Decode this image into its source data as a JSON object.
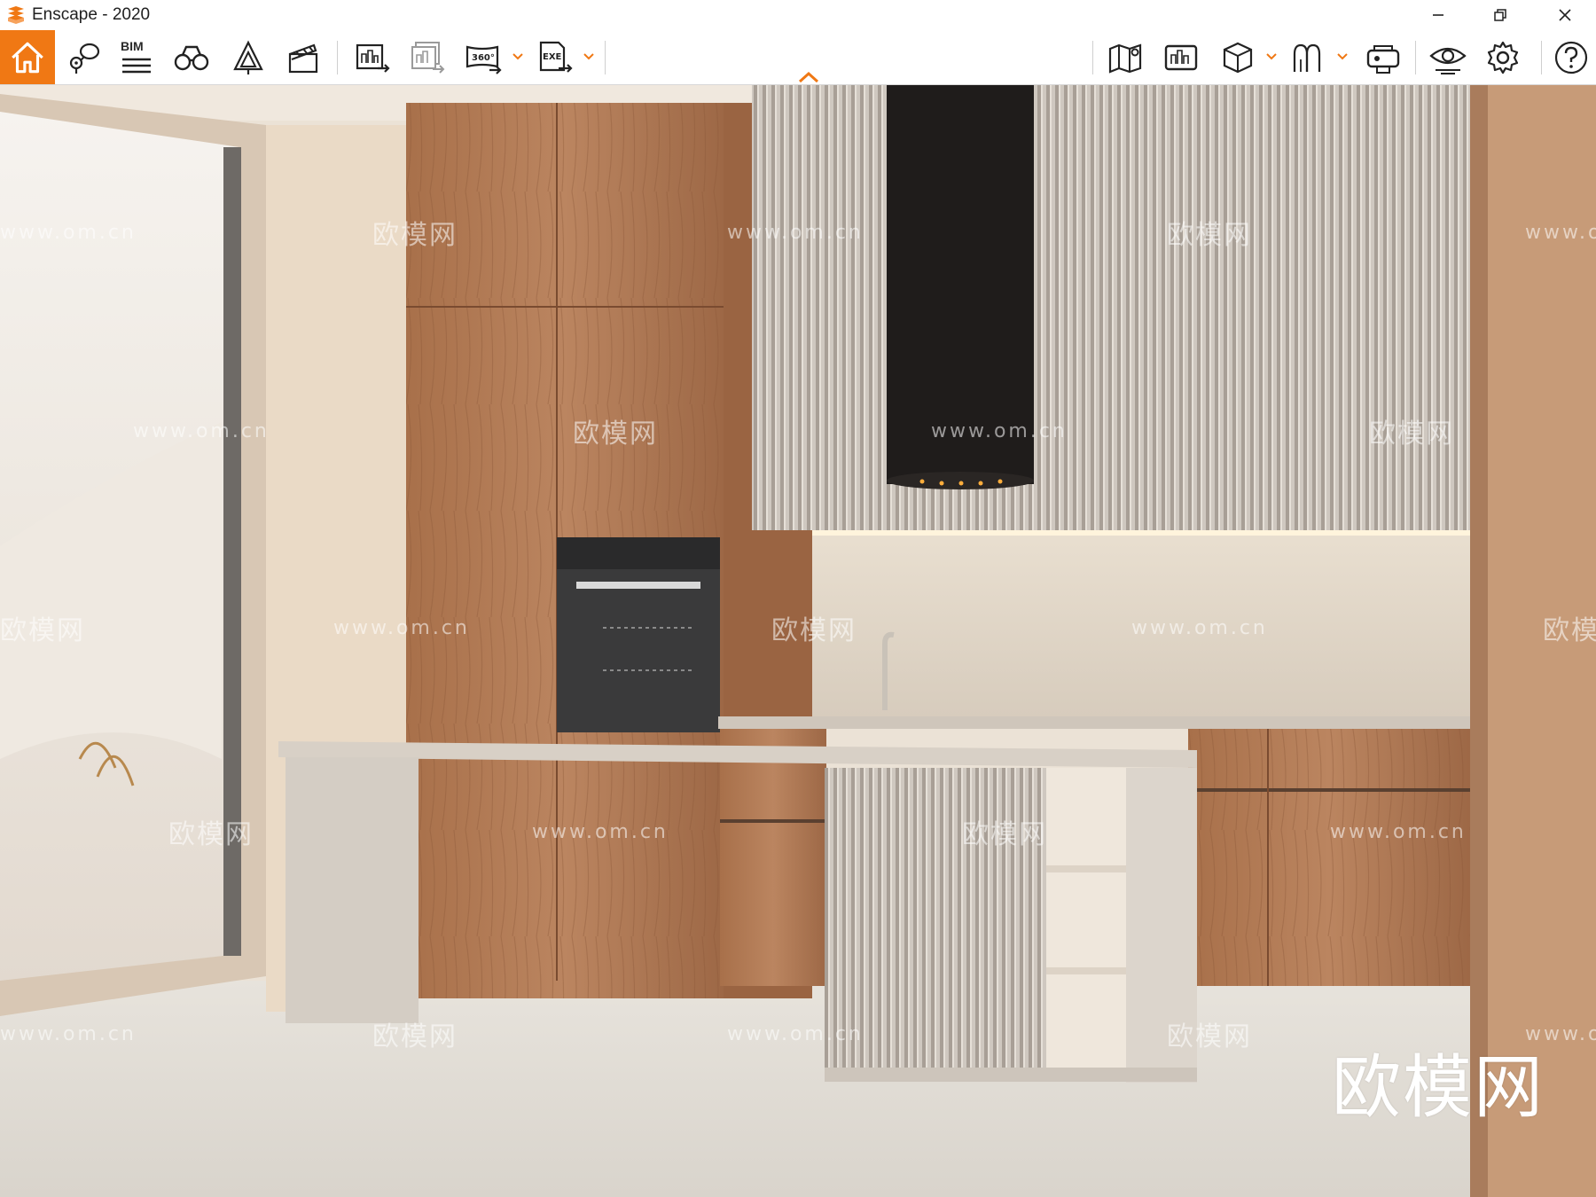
{
  "window": {
    "title": "Enscape - 2020",
    "accent_color": "#f07814",
    "controls": [
      "minimize-icon",
      "restore-icon",
      "close-icon"
    ]
  },
  "toolbar": {
    "bim_label": "BIM",
    "left_tools": [
      "home-icon",
      "view-management-icon",
      "bim-icon",
      "walk-mode-icon",
      "object-library-icon",
      "video-editor-icon"
    ],
    "export_tools": [
      "screenshot-export-icon",
      "batch-export-icon",
      "panorama-360-icon",
      "exe-export-icon"
    ],
    "panorama_label": "360°",
    "exe_label": "EXE",
    "right_tools": [
      "map-icon",
      "batch-render-icon",
      "asset-cube-icon",
      "upload-icon",
      "vr-headset-icon",
      "visual-settings-icon",
      "general-settings-icon",
      "help-icon"
    ]
  },
  "viewport": {
    "watermark_text": "欧模网",
    "watermark_url": "www.om.cn",
    "watermark_big": "欧模网"
  }
}
